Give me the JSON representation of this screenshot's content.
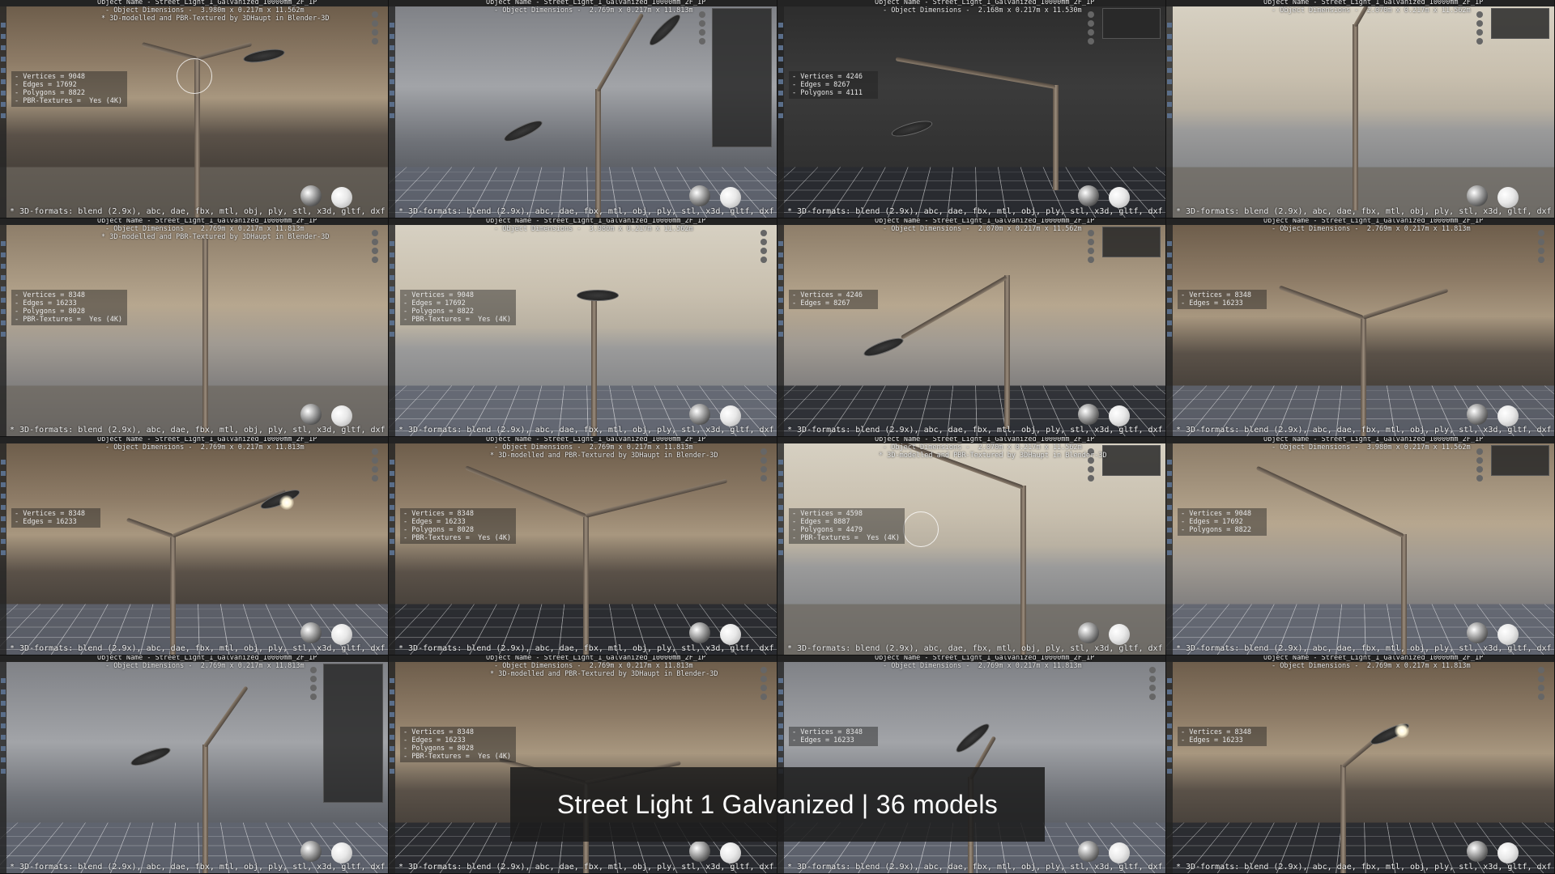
{
  "banner": {
    "title": "Street Light 1 Galvanized | 36 models"
  },
  "formats_text": "* 3D-formats: blend (2.9x), abc, dae, fbx, mtl, obj, ply, stl, x3d, gltf, dxf",
  "object_name_line": "Object Name - Street_Light_1_Galvanized_10000mm_2F_1P",
  "modelled_line": "* 3D-modelled and PBR-Textured by 3DHaupt in Blender-3D",
  "tiles": [
    {
      "dims": "- Object Dimensions -  3.980m x 0.217m x 11.562m",
      "stats": [
        "- Vertices = 9048",
        "- Edges = 17692",
        "- Polygons = 8822",
        "- PBR-Textures =  Yes (4K)"
      ]
    },
    {
      "dims": "- Object Dimensions -  2.769m x 0.217m x 11.813m",
      "stats": []
    },
    {
      "dims": "- Object Dimensions -  2.168m x 0.217m x 11.530m",
      "stats": [
        "- Vertices = 4246",
        "- Edges = 8267",
        "- Polygons = 4111"
      ]
    },
    {
      "dims": "- Object Dimensions -  2.070m x 0.217m x 11.562m",
      "stats": []
    },
    {
      "dims": "- Object Dimensions -  2.769m x 0.217m x 11.813m",
      "stats": [
        "- Vertices = 8348",
        "- Edges = 16233",
        "- Polygons = 8028",
        "- PBR-Textures =  Yes (4K)"
      ]
    },
    {
      "dims": "- Object Dimensions -  3.980m x 0.217m x 11.562m",
      "stats": [
        "- Vertices = 9048",
        "- Edges = 17692",
        "- Polygons = 8822",
        "- PBR-Textures =  Yes (4K)"
      ]
    },
    {
      "dims": "- Object Dimensions -  2.070m x 0.217m x 11.562m",
      "stats": [
        "- Vertices = 4246",
        "- Edges = 8267"
      ]
    },
    {
      "dims": "- Object Dimensions -  2.769m x 0.217m x 11.813m",
      "stats": [
        "- Vertices = 8348",
        "- Edges = 16233"
      ]
    },
    {
      "dims": "- Object Dimensions -  2.769m x 0.217m x 11.813m",
      "stats": [
        "- Vertices = 8348",
        "- Edges = 16233"
      ]
    },
    {
      "dims": "- Object Dimensions -  2.769m x 0.217m x 11.813m",
      "stats": [
        "- Vertices = 8348",
        "- Edges = 16233",
        "- Polygons = 8028",
        "- PBR-Textures =  Yes (4K)"
      ]
    },
    {
      "dims": "- Object Dimensions -  2.070m x 0.217m x 11.562m",
      "stats": [
        "- Vertices = 4598",
        "- Edges = 8887",
        "- Polygons = 4479",
        "- PBR-Textures =  Yes (4K)"
      ]
    },
    {
      "dims": "- Object Dimensions -  3.980m x 0.217m x 11.562m",
      "stats": [
        "- Vertices = 9048",
        "- Edges = 17692",
        "- Polygons = 8822"
      ]
    },
    {
      "dims": "- Object Dimensions -  2.769m x 0.217m x 11.813m",
      "stats": []
    },
    {
      "dims": "- Object Dimensions -  2.769m x 0.217m x 11.813m",
      "stats": [
        "- Vertices = 8348",
        "- Edges = 16233",
        "- Polygons = 8028",
        "- PBR-Textures =  Yes (4K)"
      ]
    },
    {
      "dims": "- Object Dimensions -  2.769m x 0.217m x 11.813m",
      "stats": [
        "- Vertices = 8348",
        "- Edges = 16233"
      ]
    },
    {
      "dims": "- Object Dimensions -  2.769m x 0.217m x 11.813m",
      "stats": [
        "- Vertices = 8348",
        "- Edges = 16233"
      ]
    }
  ]
}
